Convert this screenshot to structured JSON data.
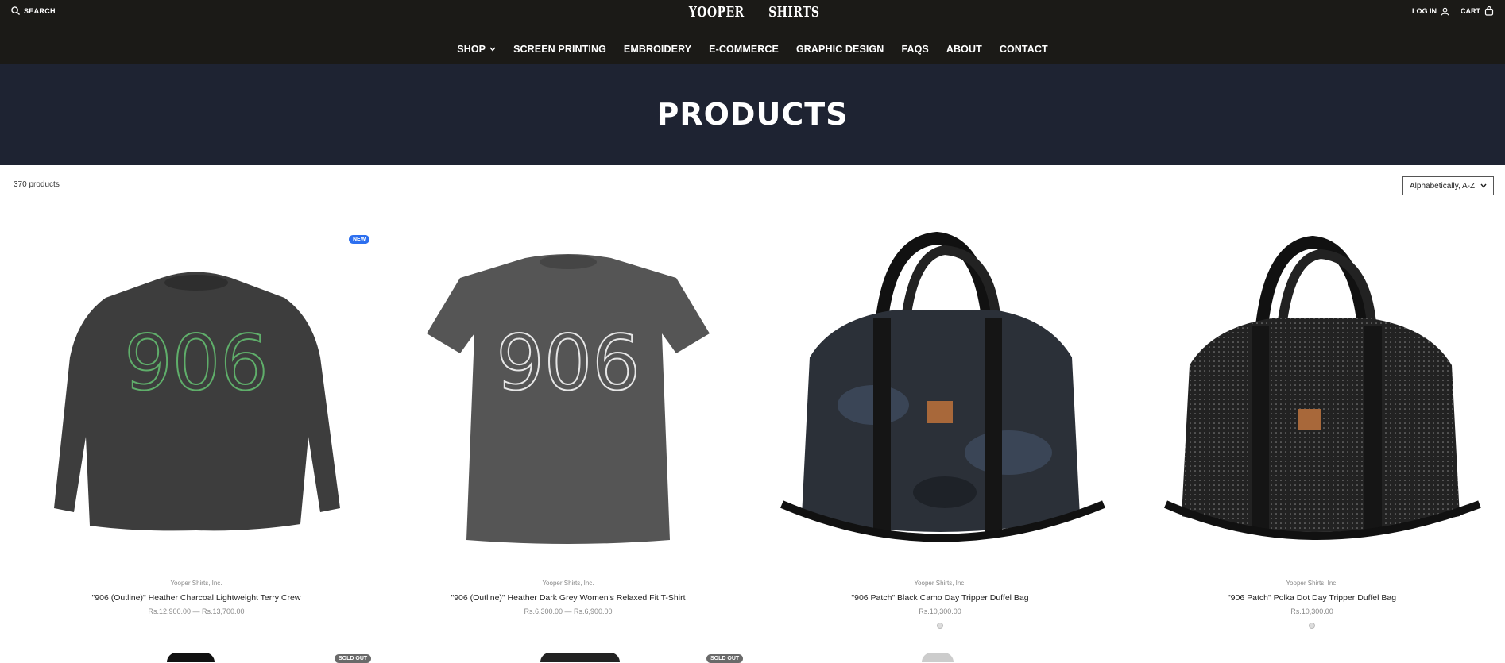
{
  "header": {
    "search_label": "SEARCH",
    "logo_left": "YOOPER",
    "logo_right": "SHIRTS",
    "login_label": "LOG IN",
    "cart_label": "CART"
  },
  "nav": {
    "items": [
      "SHOP",
      "SCREEN PRINTING",
      "EMBROIDERY",
      "E-COMMERCE",
      "GRAPHIC DESIGN",
      "FAQS",
      "ABOUT",
      "CONTACT"
    ]
  },
  "hero": {
    "title": "PRODUCTS"
  },
  "toolbar": {
    "count": "370 products",
    "sort_value": "Alphabetically, A-Z"
  },
  "products": [
    {
      "vendor": "Yooper Shirts, Inc.",
      "title": "\"906 (Outline)\" Heather Charcoal Lightweight Terry Crew",
      "price": "Rs.12,900.00 — Rs.13,700.00",
      "badge": "NEW"
    },
    {
      "vendor": "Yooper Shirts, Inc.",
      "title": "\"906 (Outline)\" Heather Dark Grey Women's Relaxed Fit T-Shirt",
      "price": "Rs.6,300.00 — Rs.6,900.00"
    },
    {
      "vendor": "Yooper Shirts, Inc.",
      "title": "\"906 Patch\" Black Camo Day Tripper Duffel Bag",
      "price": "Rs.10,300.00"
    },
    {
      "vendor": "Yooper Shirts, Inc.",
      "title": "\"906 Patch\" Polka Dot Day Tripper Duffel Bag",
      "price": "Rs.10,300.00"
    }
  ],
  "second_row": {
    "badge": "SOLD OUT"
  },
  "colors": {
    "topbar": "#1b1a17",
    "hero": "#1e2332",
    "badge_new": "#2c6fef"
  }
}
